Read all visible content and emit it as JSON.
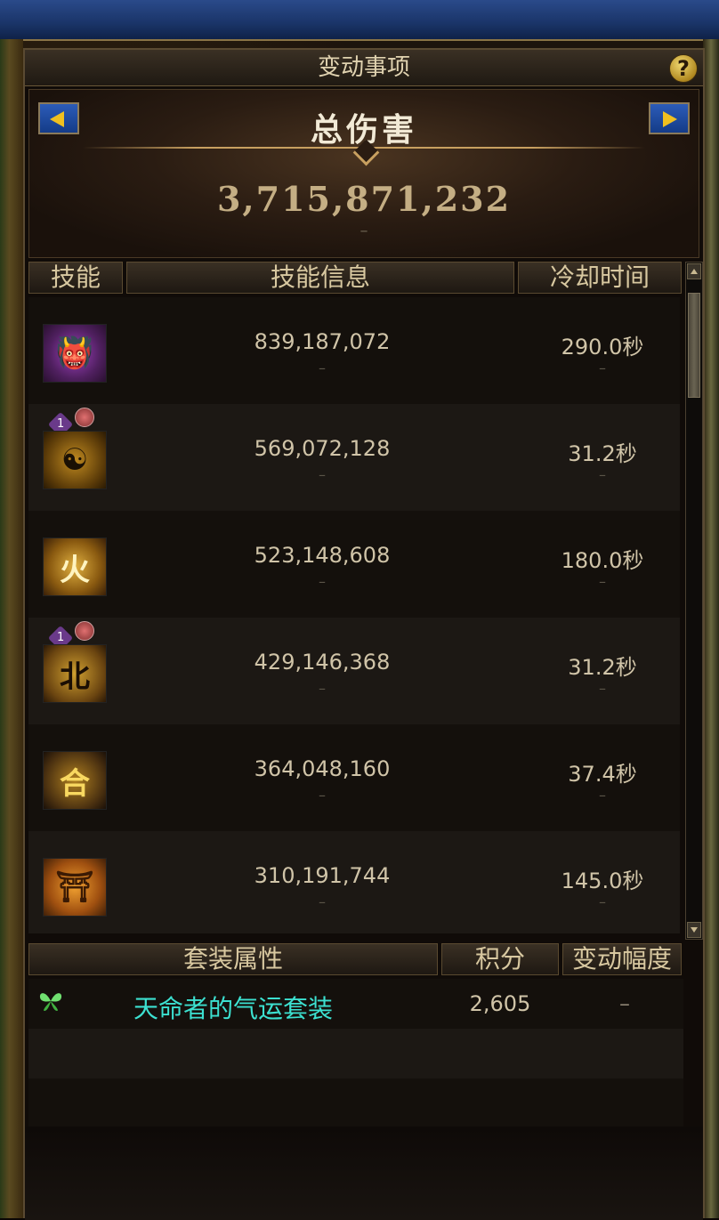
{
  "panel": {
    "title": "变动事项",
    "help_label": "?"
  },
  "summary": {
    "label": "总伤害",
    "total": "3,715,871,232",
    "change": "–"
  },
  "skills_table": {
    "columns": [
      "技能",
      "技能信息",
      "冷却时间"
    ],
    "rows": [
      {
        "icon": "demon-mask-skill-icon",
        "damage": "839,187,072",
        "damage_change": "–",
        "cooldown": "290.0秒",
        "cooldown_change": "–",
        "badges": false
      },
      {
        "icon": "yin-yang-seal-skill-icon",
        "damage": "569,072,128",
        "damage_change": "–",
        "cooldown": "31.2秒",
        "cooldown_change": "–",
        "badges": true
      },
      {
        "icon": "golden-dragon-skill-icon",
        "damage": "523,148,608",
        "damage_change": "–",
        "cooldown": "180.0秒",
        "cooldown_change": "–",
        "badges": false
      },
      {
        "icon": "calligraphy-skill-icon",
        "damage": "429,146,368",
        "damage_change": "–",
        "cooldown": "31.2秒",
        "cooldown_change": "–",
        "badges": true
      },
      {
        "icon": "he-glyph-skill-icon",
        "damage": "364,048,160",
        "damage_change": "–",
        "cooldown": "37.4秒",
        "cooldown_change": "–",
        "badges": false
      },
      {
        "icon": "golden-gate-skill-icon",
        "damage": "310,191,744",
        "damage_change": "–",
        "cooldown": "145.0秒",
        "cooldown_change": "–",
        "badges": false
      }
    ],
    "badge_labels": [
      "1",
      ""
    ]
  },
  "skill_icon_glyphs": [
    "👹",
    "☯",
    "火",
    "北",
    "合",
    "⛩"
  ],
  "set_table": {
    "columns": [
      "套装属性",
      "积分",
      "变动幅度"
    ],
    "rows": [
      {
        "icon": "butterfly-icon",
        "name": "天命者的气运套装",
        "score": "2,605",
        "change": "–"
      }
    ]
  },
  "colors": {
    "set_name": "#3ce0d0",
    "arrow_button": "#1e4aa0",
    "arrow_glyph": "#f0c020"
  }
}
